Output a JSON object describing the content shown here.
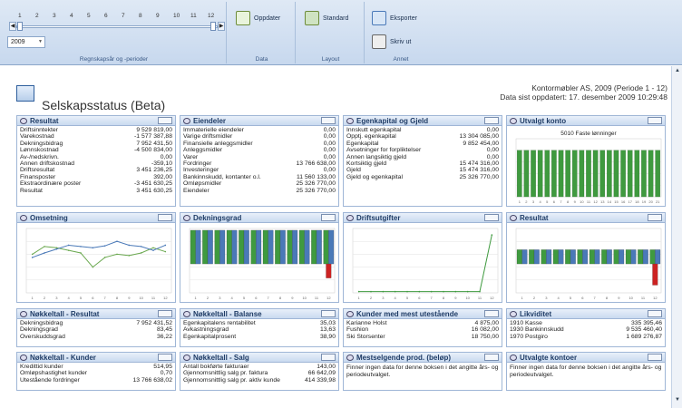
{
  "ribbon": {
    "periods": [
      "1",
      "2",
      "3",
      "4",
      "5",
      "6",
      "7",
      "8",
      "9",
      "10",
      "11",
      "12"
    ],
    "year": "2009",
    "group_periods": "Regnskapsår og -perioder",
    "group_data": "Data",
    "group_layout": "Layout",
    "group_other": "Annet",
    "update_label": "Oppdater",
    "standard_label": "Standard",
    "export_label": "Eksporter",
    "print_label": "Skriv ut"
  },
  "page": {
    "title": "Selskapsstatus (Beta)",
    "company": "Kontormøbler AS, 2009 (Periode 1 - 12)",
    "updated": "Data sist oppdatert: 17. desember 2009 10:29:48"
  },
  "panels": {
    "resultat": {
      "title": "Resultat",
      "rows": [
        [
          "Driftsinntekter",
          "9 529 819,00"
        ],
        [
          "Varekostnad",
          "-1 577 387,88"
        ],
        [
          "Dekningsbidrag",
          "7 952 431,50"
        ],
        [
          "Lønnskostnad",
          "-4 500 834,00"
        ],
        [
          "Av-/nedskrivn.",
          "0,00"
        ],
        [
          "Annen driftskostnad",
          "-359,10"
        ],
        [
          "Driftsresultat",
          "3 451 236,25"
        ],
        [
          "Finansposter",
          "392,00"
        ],
        [
          "Ekstraordinære poster",
          "-3 451 630,25"
        ],
        [
          "Resultat",
          "3 451 630,25"
        ]
      ]
    },
    "eiendeler": {
      "title": "Eiendeler",
      "rows": [
        [
          "Immaterielle eiendeler",
          "0,00"
        ],
        [
          "Varige driftsmidler",
          "0,00"
        ],
        [
          "Finansielle anleggsmidler",
          "0,00"
        ],
        [
          "Anleggsmidler",
          "0,00"
        ],
        [
          "Varer",
          "0,00"
        ],
        [
          "Fordringer",
          "13 766 638,00"
        ],
        [
          "Investeringer",
          "0,00"
        ],
        [
          "Bankinnskudd, kontanter o.l.",
          "11 560 133,00"
        ],
        [
          "Omløpsmidler",
          "25 326 770,00"
        ],
        [
          "Eiendeler",
          "25 326 770,00"
        ]
      ]
    },
    "egenkapital": {
      "title": "Egenkapital og Gjeld",
      "rows": [
        [
          "Innskutt egenkapital",
          "0,00"
        ],
        [
          "Opptj. egenkapital",
          "13 304 085,00"
        ],
        [
          "Egenkapital",
          "9 852 454,00"
        ],
        [
          "Avsetninger for forpliktelser",
          "0,00"
        ],
        [
          "Annen langsiktig gjeld",
          "0,00"
        ],
        [
          "Kortsiktig gjeld",
          "15 474 316,00"
        ],
        [
          "Gjeld",
          "15 474 316,00"
        ],
        [
          "Gjeld og egenkapital",
          "25 326 770,00"
        ]
      ]
    },
    "utvalgt_konto": {
      "title": "Utvalgt konto",
      "chart_title": "5010 Faste lønninger"
    },
    "omsetning": {
      "title": "Omsetning"
    },
    "dekningsgrad": {
      "title": "Dekningsgrad"
    },
    "driftsutgifter": {
      "title": "Driftsutgifter"
    },
    "resultat_chart": {
      "title": "Resultat"
    },
    "nk_resultat": {
      "title": "Nøkkeltall - Resultat",
      "rows": [
        [
          "Dekningsbidrag",
          "7 952 431,52"
        ],
        [
          "Dekningsgrad",
          "83,45"
        ],
        [
          "Overskuddsgrad",
          "36,22"
        ]
      ]
    },
    "nk_balanse": {
      "title": "Nøkkeltall - Balanse",
      "rows": [
        [
          "Egenkapitalens rentabilitet",
          "35,03"
        ],
        [
          "Avkastningsgrad",
          "13,63"
        ],
        [
          "Egenkapitalprosent",
          "38,90"
        ]
      ]
    },
    "kunder_utest": {
      "title": "Kunder med mest utestående",
      "rows": [
        [
          "Karianne Holst",
          "4 875,00"
        ],
        [
          "Fushion",
          "16 082,00"
        ],
        [
          "Ski Storsenter",
          "18 750,00"
        ]
      ]
    },
    "likviditet": {
      "title": "Likviditet",
      "rows": [
        [
          "1910 Kasse",
          "335 395,46"
        ],
        [
          "1930 Bankinnskudd",
          "9 535 460,40"
        ],
        [
          "1970 Postgiro",
          "1 689 276,87"
        ]
      ]
    },
    "nk_kunder": {
      "title": "Nøkkeltall - Kunder",
      "rows": [
        [
          "Kredittid kunder",
          "514,95"
        ],
        [
          "Omløpshastighet kunder",
          "0,70"
        ],
        [
          "Utestående fordringer",
          "13 766 638,02"
        ]
      ]
    },
    "nk_salg": {
      "title": "Nøkkeltall - Salg",
      "rows": [
        [
          "Antall bokførte fakturaer",
          "143,00"
        ],
        [
          "Gjennomsnittlig salg pr. faktura",
          "66 642,09"
        ],
        [
          "Gjennomsnittlig salg pr. aktiv kunde",
          "414 339,98"
        ]
      ]
    },
    "mestselgende": {
      "title": "Mestselgende prod. (beløp)",
      "message": "Finner ingen data for denne boksen i det angitte års- og periodeutvalget."
    },
    "utvalgte_kontoer": {
      "title": "Utvalgte kontoer",
      "message": "Finner ingen data for denne boksen i det angitte års- og periodeutvalget."
    }
  },
  "chart_data": [
    {
      "type": "bar",
      "title": "5010 Faste lønninger",
      "categories": [
        "1",
        "2",
        "3",
        "4",
        "5",
        "6",
        "7",
        "8",
        "9",
        "10",
        "11",
        "12",
        "13",
        "14",
        "15",
        "16",
        "17",
        "18",
        "19",
        "20",
        "21"
      ],
      "values": [
        80,
        80,
        80,
        80,
        80,
        80,
        80,
        80,
        80,
        80,
        80,
        80,
        80,
        80,
        80,
        80,
        80,
        80,
        80,
        80,
        80
      ],
      "colors": [
        "#3f9a3f"
      ]
    },
    {
      "type": "line",
      "title": "Omsetning",
      "x": [
        "1",
        "2",
        "3",
        "4",
        "5",
        "6",
        "7",
        "8",
        "9",
        "10",
        "11",
        "12"
      ],
      "series": [
        {
          "values": [
            60,
            72,
            70,
            66,
            62,
            40,
            55,
            60,
            58,
            62,
            70,
            64
          ]
        },
        {
          "values": [
            55,
            62,
            68,
            74,
            72,
            70,
            73,
            80,
            74,
            72,
            66,
            74
          ]
        }
      ],
      "colors": [
        "#6aa84f",
        "#4a79b8"
      ]
    },
    {
      "type": "bar",
      "title": "Dekningsgrad",
      "categories": [
        "1",
        "2",
        "3",
        "4",
        "5",
        "6",
        "7",
        "8",
        "9",
        "10",
        "11",
        "12"
      ],
      "series": [
        {
          "values": [
            95,
            95,
            95,
            95,
            95,
            95,
            95,
            95,
            95,
            95,
            95,
            95
          ]
        },
        {
          "values": [
            95,
            95,
            95,
            95,
            95,
            95,
            95,
            95,
            95,
            95,
            95,
            95
          ]
        },
        {
          "values": [
            0,
            0,
            0,
            0,
            0,
            0,
            0,
            0,
            0,
            0,
            0,
            -40
          ]
        }
      ],
      "colors": [
        "#3f9a3f",
        "#4a79b8",
        "#cc2222"
      ]
    },
    {
      "type": "line",
      "title": "Driftsutgifter",
      "x": [
        "1",
        "2",
        "3",
        "4",
        "5",
        "6",
        "7",
        "8",
        "9",
        "10",
        "11",
        "12"
      ],
      "series": [
        {
          "values": [
            2,
            2,
            2,
            2,
            2,
            2,
            2,
            2,
            2,
            2,
            2,
            90
          ]
        }
      ],
      "colors": [
        "#3f9a3f"
      ]
    },
    {
      "type": "bar",
      "title": "Resultat",
      "categories": [
        "1",
        "2",
        "3",
        "4",
        "5",
        "6",
        "7",
        "8",
        "9",
        "10",
        "11",
        "12"
      ],
      "series": [
        {
          "values": [
            40,
            40,
            40,
            40,
            40,
            40,
            40,
            40,
            40,
            40,
            40,
            40
          ]
        },
        {
          "values": [
            40,
            40,
            40,
            40,
            40,
            40,
            40,
            40,
            40,
            40,
            40,
            40
          ]
        },
        {
          "values": [
            0,
            0,
            0,
            0,
            0,
            0,
            0,
            0,
            0,
            0,
            0,
            -60
          ]
        }
      ],
      "colors": [
        "#3f9a3f",
        "#4a79b8",
        "#cc2222"
      ]
    }
  ]
}
